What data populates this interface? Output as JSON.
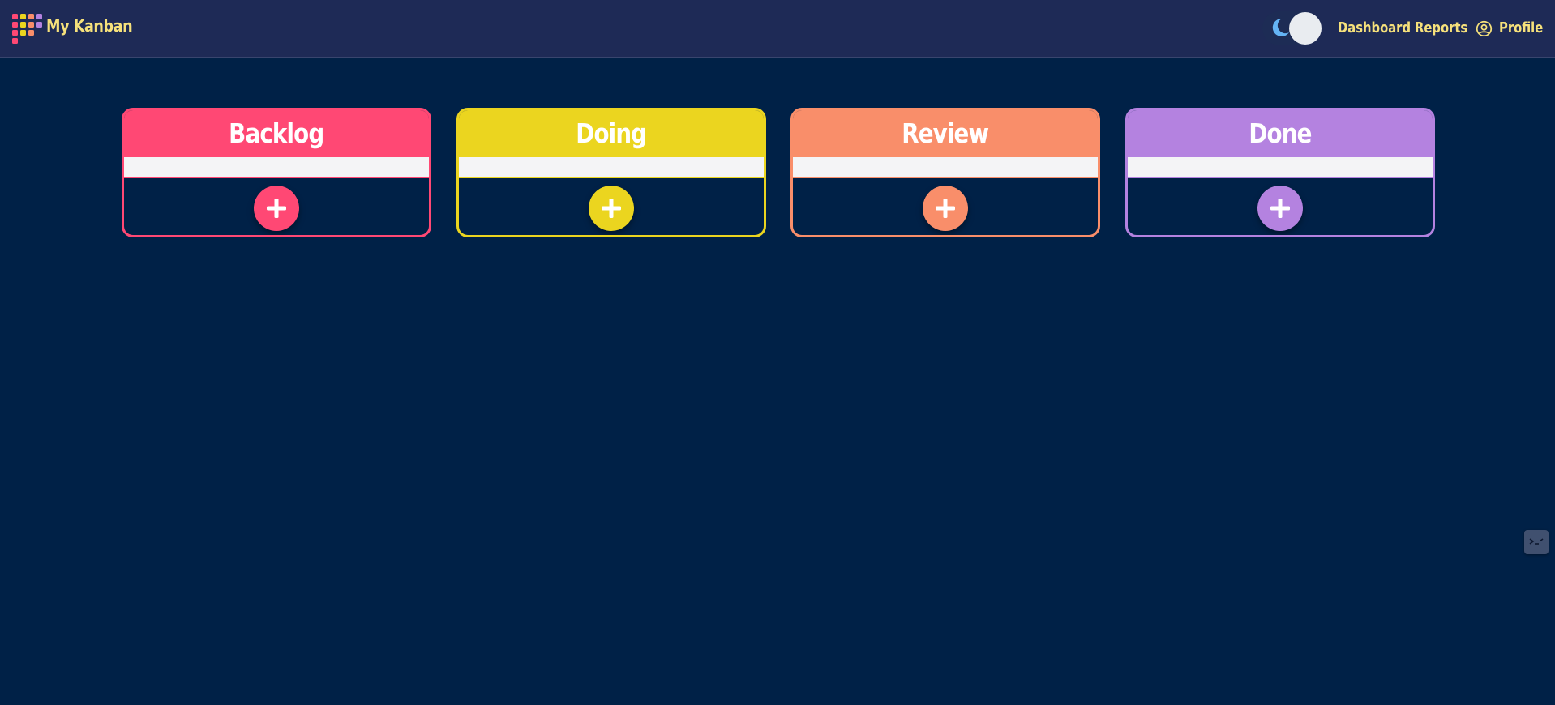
{
  "header": {
    "app_title": "My Kanban",
    "logo_icon": "grid-dots-logo-icon",
    "theme_toggle": {
      "mode": "dark",
      "icon": "moon-icon"
    },
    "nav": [
      {
        "label": "Dashboard"
      },
      {
        "label": "Reports"
      },
      {
        "label": "Profile",
        "icon": "user-circle-icon"
      }
    ],
    "text_color": "#f6e17b",
    "background": "#1e2a56"
  },
  "board": {
    "background": "#002147",
    "columns": [
      {
        "title": "Backlog",
        "color": "#ff4874",
        "add_icon": "plus-icon",
        "input_value": ""
      },
      {
        "title": "Doing",
        "color": "#ebd51f",
        "add_icon": "plus-icon",
        "input_value": ""
      },
      {
        "title": "Review",
        "color": "#f98e6a",
        "add_icon": "plus-icon",
        "input_value": ""
      },
      {
        "title": "Done",
        "color": "#b482e0",
        "add_icon": "plus-icon",
        "input_value": ""
      }
    ]
  },
  "floating_widget": {
    "icon": "console-icon"
  }
}
